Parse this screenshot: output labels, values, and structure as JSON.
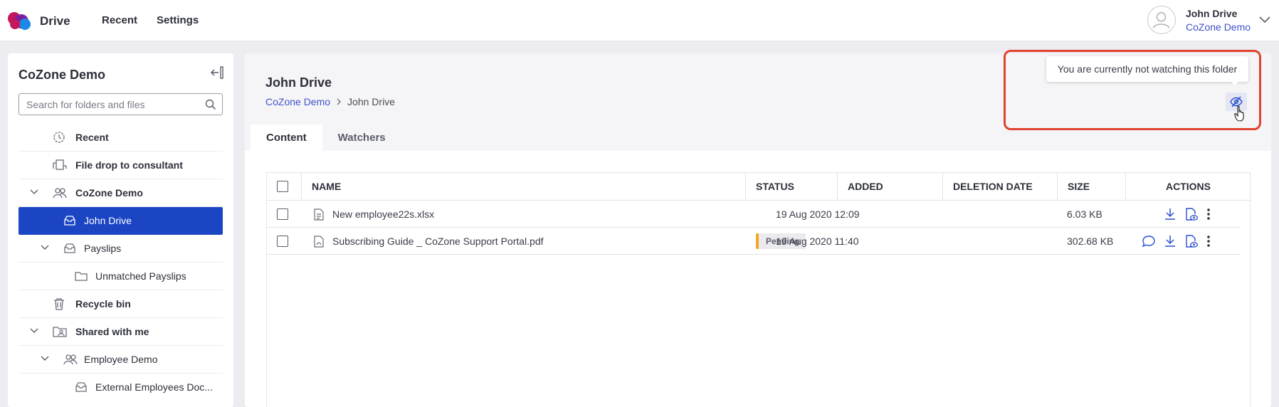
{
  "app": {
    "name": "Drive"
  },
  "nav": {
    "recent": "Recent",
    "settings": "Settings"
  },
  "user": {
    "name": "John Drive",
    "company": "CoZone Demo"
  },
  "sidebar": {
    "title": "CoZone Demo",
    "search_placeholder": "Search for folders and files",
    "items": [
      {
        "label": "Recent",
        "icon": "clock-icon"
      },
      {
        "label": "File drop to consultant",
        "icon": "file-drop-icon"
      },
      {
        "label": "CoZone Demo",
        "icon": "group-icon"
      },
      {
        "label": "John Drive",
        "icon": "drive-icon"
      },
      {
        "label": "Payslips",
        "icon": "drive-icon"
      },
      {
        "label": "Unmatched Payslips",
        "icon": "folder-icon"
      },
      {
        "label": "Recycle bin",
        "icon": "trash-icon"
      },
      {
        "label": "Shared with me",
        "icon": "shared-folder-icon"
      },
      {
        "label": "Employee Demo",
        "icon": "group-icon"
      },
      {
        "label": "External Employees Doc...",
        "icon": "drive-icon"
      }
    ]
  },
  "main": {
    "title": "John Drive",
    "breadcrumb": [
      "CoZone Demo",
      "John Drive"
    ],
    "tabs": [
      "Content",
      "Watchers"
    ],
    "watch_tooltip": "You are currently not watching this folder"
  },
  "table": {
    "columns": [
      "NAME",
      "STATUS",
      "ADDED",
      "DELETION DATE",
      "SIZE",
      "ACTIONS"
    ],
    "rows": [
      {
        "name": "New employee22s.xlsx",
        "status": "",
        "added": "19 Aug 2020 12:09",
        "deletion_date": "",
        "size": "6.03 KB"
      },
      {
        "name": "Subscribing Guide _ CoZone Support Portal.pdf",
        "status": "Pending",
        "added": "19 Aug 2020 11:40",
        "deletion_date": "",
        "size": "302.68 KB"
      }
    ]
  },
  "colors": {
    "accent": "#1c45c4",
    "link": "#3f51c9",
    "highlight": "#e0432f",
    "pending": "#f5a623"
  }
}
